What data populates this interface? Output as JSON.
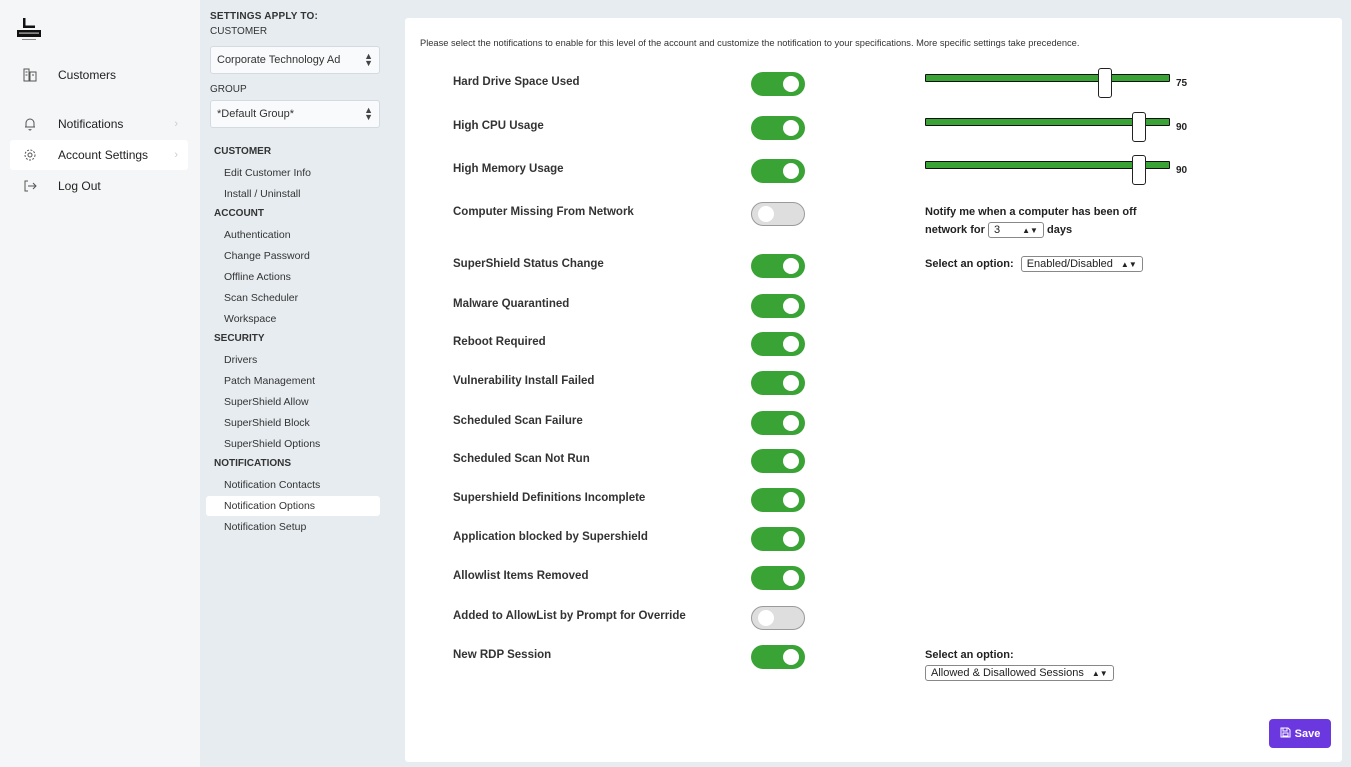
{
  "nav": {
    "items": [
      {
        "label": "Customers",
        "icon": "building-icon",
        "chevron": false
      },
      {
        "label": "Notifications",
        "icon": "bell-icon",
        "chevron": true
      },
      {
        "label": "Account Settings",
        "icon": "gear-icon",
        "chevron": true,
        "active": true
      },
      {
        "label": "Log Out",
        "icon": "logout-icon",
        "chevron": false
      }
    ]
  },
  "settings": {
    "apply_to_caption": "SETTINGS APPLY TO:",
    "customer_caption": "CUSTOMER",
    "customer_value": "Corporate Technology Ad",
    "group_caption": "GROUP",
    "group_value": "*Default Group*",
    "sections": [
      {
        "title": "CUSTOMER",
        "items": [
          "Edit Customer Info",
          "Install / Uninstall"
        ]
      },
      {
        "title": "ACCOUNT",
        "items": [
          "Authentication",
          "Change Password",
          "Offline Actions",
          "Scan Scheduler",
          "Workspace"
        ]
      },
      {
        "title": "SECURITY",
        "items": [
          "Drivers",
          "Patch Management",
          "SuperShield Allow",
          "SuperShield Block",
          "SuperShield Options"
        ]
      },
      {
        "title": "NOTIFICATIONS",
        "items": [
          "Notification Contacts",
          "Notification Options",
          "Notification Setup"
        ]
      }
    ],
    "active_item": "Notification Options"
  },
  "main": {
    "intro": "Please select the notifications to enable for this level of the account and customize the notification to your specifications. More specific settings take precedence.",
    "rows": [
      {
        "label": "Hard Drive Space Used",
        "enabled": true,
        "slider": 75
      },
      {
        "label": "High CPU Usage",
        "enabled": true,
        "slider": 90
      },
      {
        "label": "High Memory Usage",
        "enabled": true,
        "slider": 90
      },
      {
        "label": "Computer Missing From Network",
        "enabled": false
      },
      {
        "label": "SuperShield Status Change",
        "enabled": true
      },
      {
        "label": "Malware Quarantined",
        "enabled": true
      },
      {
        "label": "Reboot Required",
        "enabled": true
      },
      {
        "label": "Vulnerability Install Failed",
        "enabled": true
      },
      {
        "label": "Scheduled Scan Failure",
        "enabled": true
      },
      {
        "label": "Scheduled Scan Not Run",
        "enabled": true
      },
      {
        "label": "Supershield Definitions Incomplete",
        "enabled": true
      },
      {
        "label": "Application blocked by Supershield",
        "enabled": true
      },
      {
        "label": "Allowlist Items Removed",
        "enabled": true
      },
      {
        "label": "Added to AllowList by Prompt for Override",
        "enabled": false
      },
      {
        "label": "New RDP Session",
        "enabled": true
      }
    ],
    "offline": {
      "line1": "Notify me when a computer has been off",
      "line2_prefix": "network for",
      "days_value": "3",
      "line2_suffix": "days"
    },
    "status_option": {
      "label": "Select an option:",
      "value": "Enabled/Disabled"
    },
    "rdp_option": {
      "label": "Select an option:",
      "value": "Allowed & Disallowed Sessions"
    },
    "save_label": "Save"
  },
  "colors": {
    "toggle_on": "#3aa335",
    "save_button": "#6b38e0"
  }
}
